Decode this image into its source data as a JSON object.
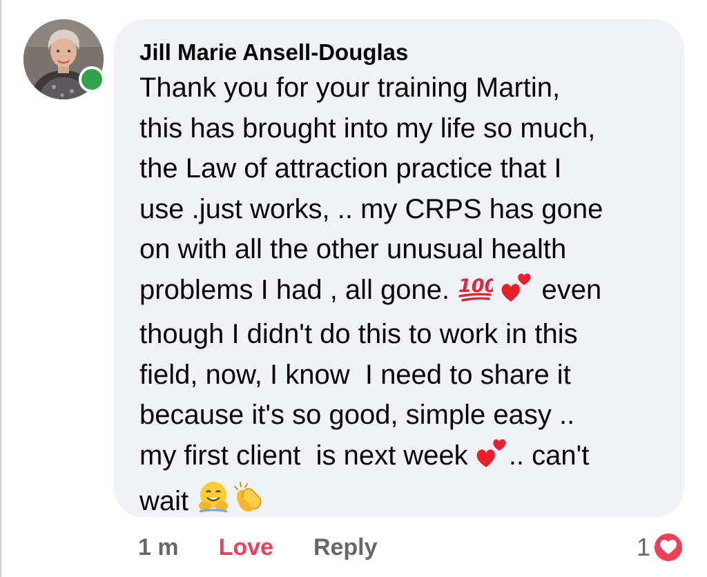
{
  "comment": {
    "author": "Jill Marie Ansell-Douglas",
    "lines": [
      "Thank you for your training Martin,",
      "this has brought into my life so much,",
      "the Law of attraction practice that I",
      "use .just works, .. my CRPS has gone",
      "on with all the other unusual health",
      "problems I had , all gone.",
      "even",
      "though I didn't do this to work in this",
      "field, now, I know  I need to share it",
      "because it's so good, simple easy ..",
      "my first client  is next week",
      ".. can't",
      "wait"
    ],
    "emojis": [
      "hundred-points-emoji",
      "two-hearts-emoji",
      "hugging-face-emoji",
      "clapping-hands-emoji"
    ],
    "online_status": "active",
    "colors": {
      "bubble": "#f0f2f5",
      "online": "#31a24c",
      "love": "#f33e58",
      "meta": "#65676b"
    }
  },
  "actions": {
    "time": "1 m",
    "love_label": "Love",
    "reply_label": "Reply"
  },
  "reactions": {
    "count": "1",
    "icon": "heart-reaction-icon"
  }
}
